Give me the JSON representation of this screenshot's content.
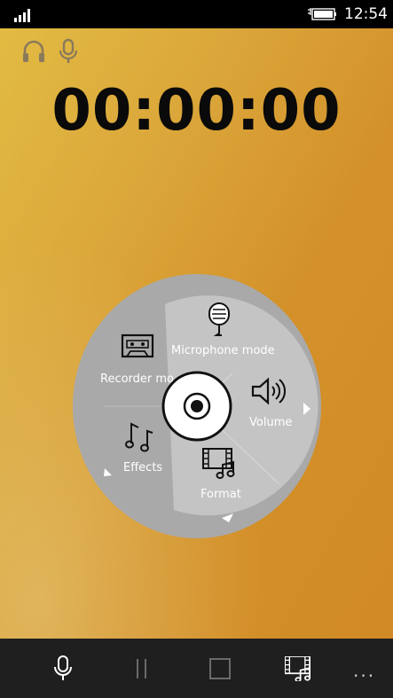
{
  "status_bar": {
    "time": "12:54"
  },
  "timer": {
    "value": "00:00:00"
  },
  "wheel": {
    "microphone_mode": "Microphone mode",
    "recorder_mode": "Recorder mode",
    "volume": "Volume",
    "effects": "Effects",
    "format": "Format"
  },
  "app_bar": {
    "more": "..."
  },
  "icons": [
    "signal-icon",
    "battery-icon",
    "headphones-icon",
    "microphone-icon",
    "cassette-icon",
    "music-notes-icon",
    "speaker-icon",
    "film-music-icon",
    "record-disc-icon",
    "pause-icon",
    "stop-icon"
  ],
  "colors": {
    "background_top": "#e2bb43",
    "background_bottom": "#d18a25",
    "wheel_outer": "#a9a9a9",
    "wheel_inner": "#c4c4c4",
    "bar": "#1f1f1f"
  }
}
